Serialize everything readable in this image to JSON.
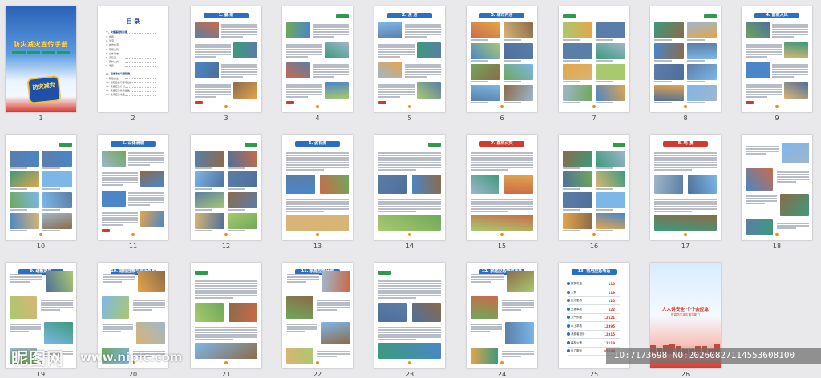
{
  "cover": {
    "title": "防灾减灾宣传手册",
    "badge": "防灾减灾"
  },
  "toc": {
    "title": "目 录",
    "sections": [
      {
        "heading": "一、灾害基础知识篇",
        "items": [
          "1. 暴雨",
          "2. 洪涝",
          "3. 城市内涝",
          "4. 雷雨大风",
          "5. 山体滑坡",
          "6. 泥石流",
          "7. 森林火灾",
          "8. 地震"
        ]
      },
      {
        "heading": "二、应急准备与避险篇",
        "items": [
          "9. 疏散逃生",
          "10. 避险自救与现场急救",
          "11. 家庭应急计划",
          "12. 家庭应急物资准备",
          "13. 常用应急电话"
        ]
      }
    ]
  },
  "pages": [
    {
      "num": "1"
    },
    {
      "num": "2"
    },
    {
      "num": "3",
      "title": "1. 暴 雨"
    },
    {
      "num": "4"
    },
    {
      "num": "5",
      "title": "2. 洪 涝"
    },
    {
      "num": "6",
      "title": "3. 城市内涝"
    },
    {
      "num": "7"
    },
    {
      "num": "8"
    },
    {
      "num": "9",
      "title": "4. 雷雨大风"
    },
    {
      "num": "10"
    },
    {
      "num": "11",
      "title": "5. 山体滑坡"
    },
    {
      "num": "12"
    },
    {
      "num": "13",
      "title": "6. 泥石流"
    },
    {
      "num": "14"
    },
    {
      "num": "15",
      "title": "7. 森林火灾"
    },
    {
      "num": "16"
    },
    {
      "num": "17",
      "title": "8. 地 震"
    },
    {
      "num": "18"
    },
    {
      "num": "19",
      "title": "9. 疏散逃生"
    },
    {
      "num": "20",
      "title": "10. 避险自救与现场急救"
    },
    {
      "num": "21"
    },
    {
      "num": "22",
      "title": "11. 家庭应急计划"
    },
    {
      "num": "23"
    },
    {
      "num": "24",
      "title": "12. 家庭应急物资准备"
    },
    {
      "num": "25",
      "title": "13. 常用应急电话"
    },
    {
      "num": "26"
    }
  ],
  "phones": [
    {
      "name": "报警电话",
      "number": "110"
    },
    {
      "name": "火警",
      "number": "119"
    },
    {
      "name": "医疗急救",
      "number": "120"
    },
    {
      "name": "交通事故",
      "number": "122"
    },
    {
      "name": "天气预报",
      "number": "12121"
    },
    {
      "name": "水上求救",
      "number": "12395"
    },
    {
      "name": "消费者投诉",
      "number": "12315"
    },
    {
      "name": "森林火警",
      "number": "12119"
    },
    {
      "name": "电力服务",
      "number": "95598"
    }
  ],
  "back": {
    "title": "人人讲安全 个个会应急",
    "subtitle": "提高防灾减灾救灾能力"
  },
  "watermark": {
    "brand": "昵图网",
    "url": "www.nipic.com",
    "id": "ID:7173698 NO:20260827114553608100"
  },
  "colors": {
    "blue": "#2a6fc4",
    "red": "#d33a2f",
    "green": "#2e9b4a",
    "orange": "#f08a1c"
  }
}
